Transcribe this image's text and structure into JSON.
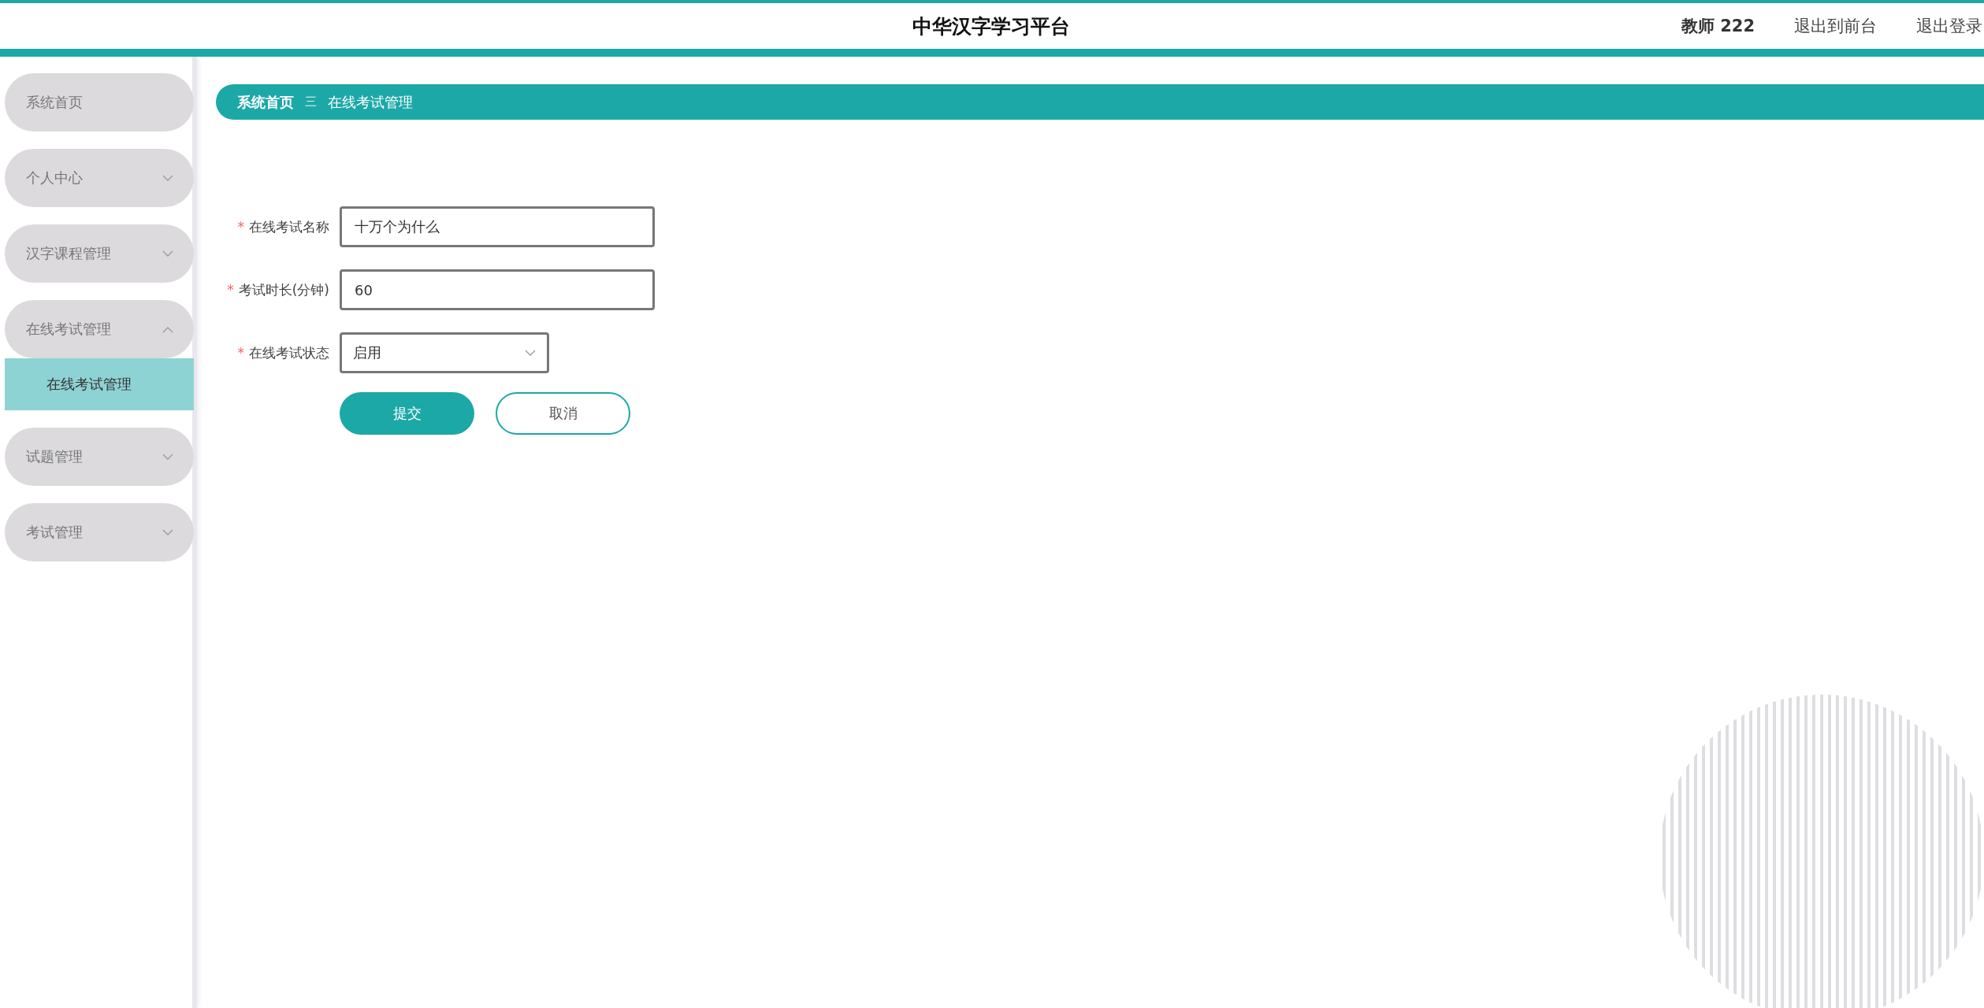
{
  "header": {
    "title": "中华汉字学习平台",
    "user": "教师 222",
    "links": [
      "退出到前台",
      "退出登录"
    ]
  },
  "sidebar": {
    "items": [
      {
        "label": "系统首页"
      },
      {
        "label": "个人中心",
        "expanded": false
      },
      {
        "label": "汉字课程管理",
        "expanded": false
      },
      {
        "label": "在线考试管理",
        "expanded": true,
        "children": [
          {
            "label": "在线考试管理",
            "selected": true
          }
        ]
      },
      {
        "label": "试题管理",
        "expanded": false
      },
      {
        "label": "考试管理",
        "expanded": false
      }
    ]
  },
  "breadcrumb": {
    "items": [
      "系统首页",
      "在线考试管理"
    ],
    "separator": "三"
  },
  "form": {
    "fields": [
      {
        "kind": "input",
        "label": "在线考试名称",
        "required_mark": "*",
        "value": "十万个为什么"
      },
      {
        "kind": "input",
        "label": "考试时长(分钟)",
        "required_mark": "*",
        "value": "60"
      },
      {
        "kind": "select",
        "label": "在线考试状态",
        "required_mark": "*",
        "value": "启用"
      }
    ],
    "buttons": [
      {
        "kind": "primary",
        "label": "提交"
      },
      {
        "kind": "secondary",
        "label": "取消"
      }
    ]
  }
}
